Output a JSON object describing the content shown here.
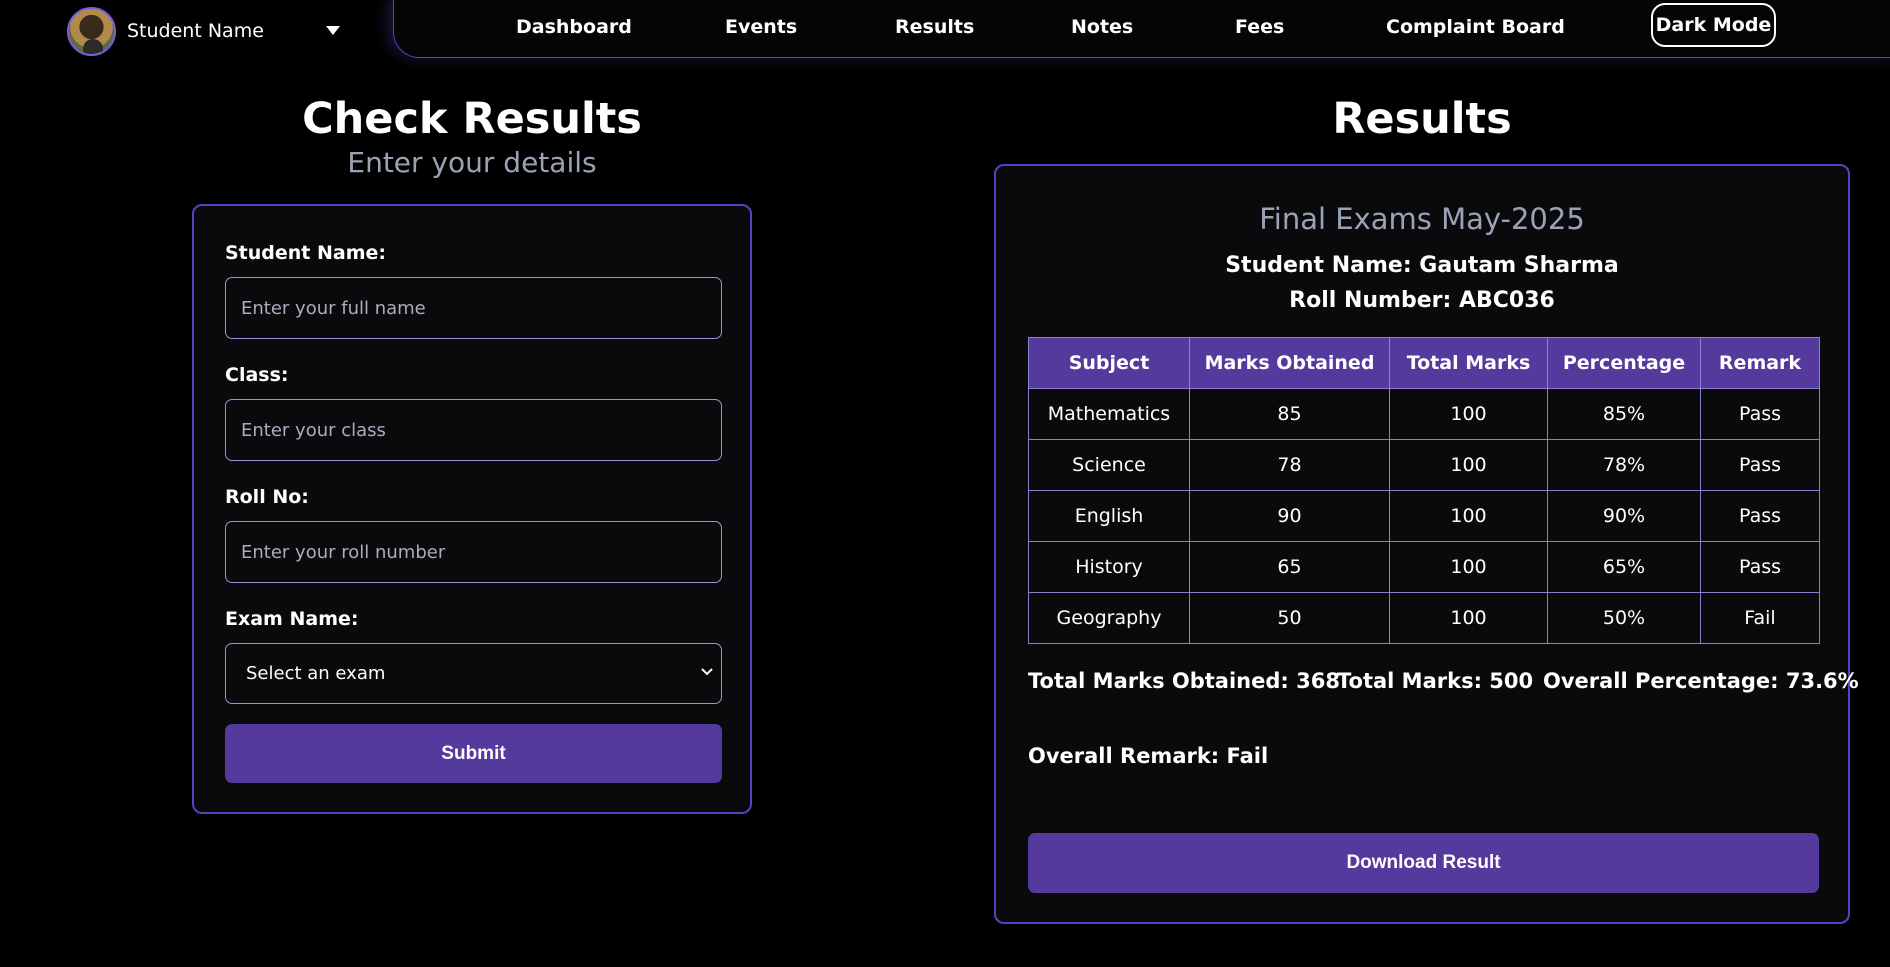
{
  "profile": {
    "name": "Student Name",
    "avatar_icon": "user-avatar",
    "menu_icon": "caret-down-icon"
  },
  "nav": {
    "items": [
      "Dashboard",
      "Events",
      "Results",
      "Notes",
      "Fees",
      "Complaint Board"
    ],
    "theme_toggle": "Dark Mode"
  },
  "form": {
    "heading": "Check Results",
    "subheading": "Enter your details",
    "fields": [
      {
        "label": "Student Name:",
        "placeholder": "Enter your full name",
        "value": ""
      },
      {
        "label": "Class:",
        "placeholder": "Enter your class",
        "value": ""
      },
      {
        "label": "Roll No:",
        "placeholder": "Enter your roll number",
        "value": ""
      }
    ],
    "exam_label": "Exam Name:",
    "exam_selected": "Select an exam",
    "submit_label": "Submit"
  },
  "results": {
    "heading": "Results",
    "exam_title": "Final Exams May-2025",
    "student_line": "Student Name: Gautam Sharma",
    "roll_line": "Roll Number: ABC036",
    "table": {
      "headers": [
        "Subject",
        "Marks Obtained",
        "Total Marks",
        "Percentage",
        "Remark"
      ],
      "rows": [
        [
          "Mathematics",
          "85",
          "100",
          "85%",
          "Pass"
        ],
        [
          "Science",
          "78",
          "100",
          "78%",
          "Pass"
        ],
        [
          "English",
          "90",
          "100",
          "90%",
          "Pass"
        ],
        [
          "History",
          "65",
          "100",
          "65%",
          "Pass"
        ],
        [
          "Geography",
          "50",
          "100",
          "50%",
          "Fail"
        ]
      ]
    },
    "total_obtained": "Total Marks Obtained: 368",
    "total_marks": "Total Marks: 500",
    "overall_percentage": "Overall Percentage: 73.6%",
    "overall_remark": "Overall Remark: Fail",
    "download_label": "Download Result"
  },
  "colors": {
    "background": "#000000",
    "accent": "#543a9c",
    "border": "#5b3fc4",
    "muted_text": "#9aa3b6"
  }
}
